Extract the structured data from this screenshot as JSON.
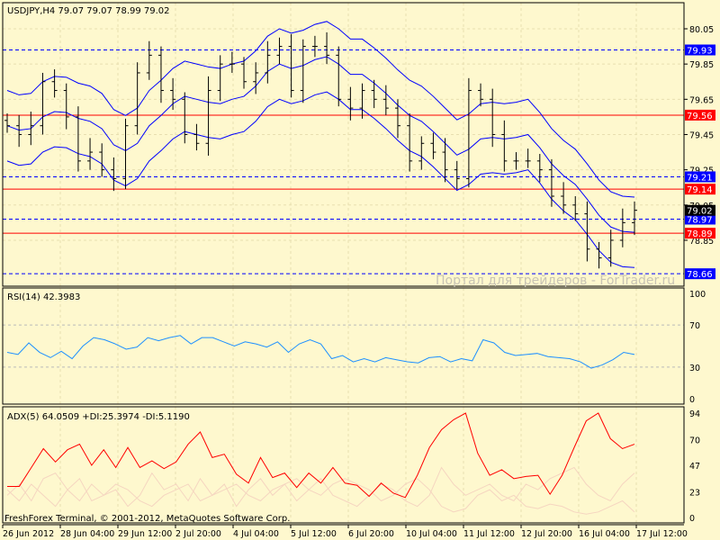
{
  "symbol_header": "USDJPY,H4  79.07 79.07 78.99 79.02",
  "watermark": "Портал для трейдеров - ForTrader.ru",
  "copyright": "FreshForex Terminal, © 2001-2012, MetaQuotes Software Corp.",
  "colors": {
    "background": "#FEF8CE",
    "bands": "#0000FF",
    "rsi": "#1E90FF",
    "adx": "#FF0000",
    "di": "#F5D5C0",
    "red_level": "#FF0000",
    "blue_level": "#0000FF"
  },
  "price_axis": {
    "ticks": [
      "80.05",
      "79.85",
      "79.65",
      "79.45",
      "79.25",
      "79.05",
      "78.85"
    ],
    "range": [
      78.63,
      80.2
    ]
  },
  "levels": [
    {
      "price": 79.93,
      "label": "79.93",
      "color": "blue",
      "style": "dashed"
    },
    {
      "price": 79.56,
      "label": "79.56",
      "color": "red",
      "style": "solid"
    },
    {
      "price": 79.21,
      "label": "79.21",
      "color": "blue",
      "style": "dashed"
    },
    {
      "price": 79.14,
      "label": "79.14",
      "color": "red",
      "style": "solid"
    },
    {
      "price": 78.97,
      "label": "78.97",
      "color": "blue",
      "style": "dashed"
    },
    {
      "price": 78.89,
      "label": "78.89",
      "color": "red",
      "style": "solid"
    },
    {
      "price": 78.66,
      "label": "78.66",
      "color": "blue",
      "style": "dashed"
    }
  ],
  "current_price": {
    "price": 79.02,
    "label": "79.02"
  },
  "closes": [
    79.5,
    79.45,
    79.5,
    79.75,
    79.7,
    79.55,
    79.3,
    79.35,
    79.25,
    79.2,
    79.5,
    79.8,
    79.9,
    79.7,
    79.65,
    79.45,
    79.4,
    79.7,
    79.85,
    79.85,
    79.75,
    79.8,
    79.9,
    79.95,
    79.7,
    79.95,
    79.95,
    79.9,
    79.65,
    79.6,
    79.7,
    79.65,
    79.6,
    79.5,
    79.3,
    79.4,
    79.35,
    79.25,
    79.2,
    79.7,
    79.65,
    79.45,
    79.3,
    79.3,
    79.3,
    79.25,
    79.1,
    79.05,
    79.0,
    78.8,
    78.75,
    78.85,
    78.95,
    79.02
  ],
  "rsi": {
    "label": "RSI(14) 42.3983",
    "ticks": [
      "100",
      "70",
      "30",
      "0"
    ],
    "levels": [
      70,
      30
    ],
    "values": [
      44,
      42,
      53,
      44,
      39,
      45,
      38,
      50,
      58,
      56,
      52,
      47,
      49,
      58,
      55,
      58,
      60,
      52,
      58,
      58,
      54,
      50,
      54,
      52,
      49,
      54,
      44,
      52,
      56,
      52,
      38,
      41,
      35,
      38,
      35,
      39,
      37,
      35,
      34,
      39,
      40,
      35,
      38,
      36,
      56,
      53,
      44,
      41,
      42,
      43,
      40,
      39,
      38,
      35,
      29,
      32,
      37,
      44,
      42
    ]
  },
  "adx": {
    "label": "ADX(5) 64.0509 +DI:25.3974 -DI:5.1190",
    "ticks": [
      "94",
      "70",
      "47",
      "23",
      "0"
    ],
    "values": [
      28,
      28,
      45,
      62,
      50,
      61,
      66,
      47,
      61,
      45,
      63,
      45,
      51,
      44,
      50,
      66,
      77,
      54,
      57,
      39,
      31,
      54,
      36,
      40,
      27,
      40,
      31,
      45,
      31,
      29,
      19,
      31,
      22,
      18,
      38,
      63,
      79,
      88,
      94,
      58,
      38,
      43,
      35,
      37,
      38,
      21,
      38,
      63,
      87,
      94,
      71,
      62,
      66
    ],
    "plus_di": [
      20,
      30,
      15,
      35,
      40,
      25,
      15,
      30,
      20,
      25,
      10,
      20,
      40,
      25,
      30,
      15,
      35,
      20,
      30,
      10,
      25,
      35,
      20,
      30,
      15,
      25,
      35,
      20,
      15,
      10,
      20,
      30,
      25,
      15,
      10,
      20,
      45,
      30,
      20,
      25,
      30,
      20,
      15,
      30,
      25,
      35,
      40,
      45,
      30,
      20,
      15,
      30,
      40
    ],
    "minus_di": [
      25,
      15,
      30,
      20,
      10,
      25,
      35,
      15,
      20,
      30,
      25,
      15,
      10,
      20,
      25,
      30,
      15,
      20,
      25,
      30,
      20,
      15,
      25,
      30,
      35,
      25,
      20,
      30,
      35,
      30,
      25,
      15,
      20,
      30,
      35,
      25,
      10,
      5,
      8,
      20,
      25,
      15,
      20,
      10,
      8,
      12,
      10,
      5,
      3,
      5,
      10,
      15,
      5
    ]
  },
  "time_axis": [
    "26 Jun 2012",
    "28 Jun 04:00",
    "29 Jun 12:00",
    "2 Jul 20:00",
    "4 Jul 04:00",
    "5 Jul 12:00",
    "6 Jul 20:00",
    "10 Jul 04:00",
    "11 Jul 12:00",
    "12 Jul 20:00",
    "16 Jul 04:00",
    "17 Jul 12:00"
  ]
}
